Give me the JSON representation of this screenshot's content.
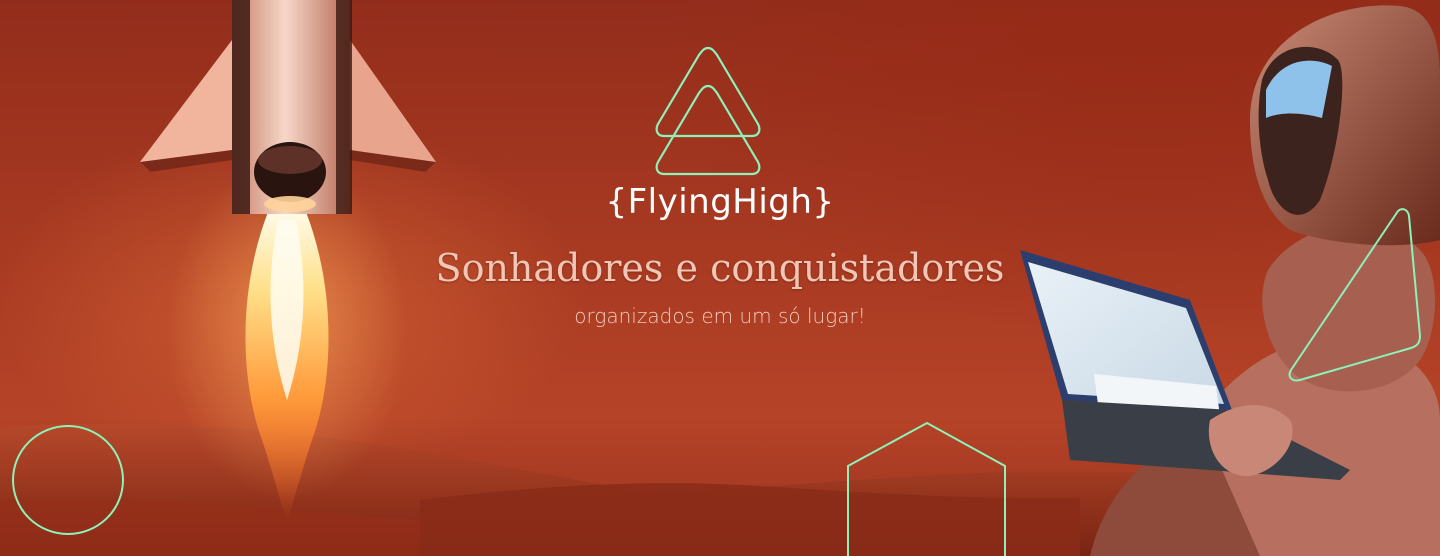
{
  "hero": {
    "brand": "{FlyingHigh}",
    "headline": "Sonhadores e conquistadores",
    "tagline": "organizados em um só lugar!"
  },
  "colors": {
    "sky": "#9a3220",
    "ground": "#7c2414",
    "accent_outline": "#8ff0b8",
    "text_primary": "#ffffff",
    "text_secondary": "#f0c6b5"
  },
  "icons": {
    "logo": "double-triangle-logo-icon",
    "decorations": [
      "circle-outline-icon",
      "hexagon-outline-icon",
      "triangle-outline-icon"
    ]
  }
}
